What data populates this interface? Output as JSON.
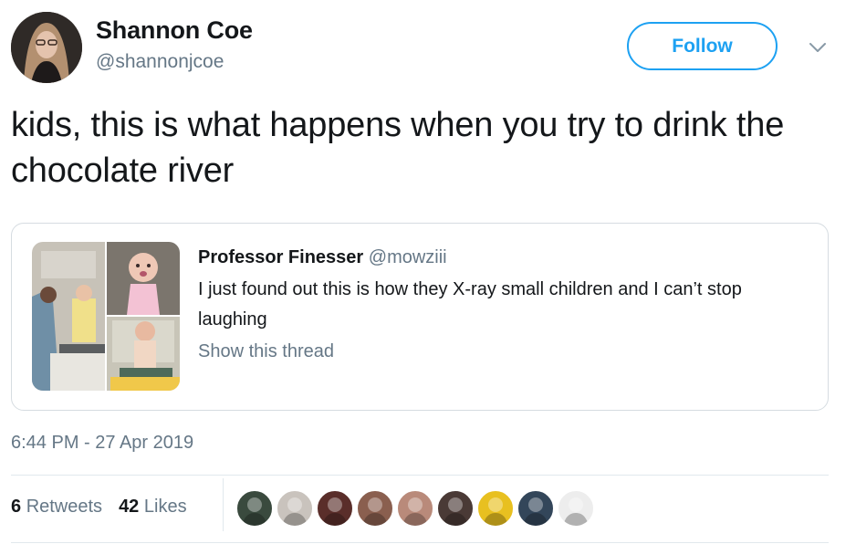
{
  "author": {
    "name": "Shannon Coe",
    "handle": "@shannonjcoe",
    "avatar_icon": "user-avatar-photo"
  },
  "follow_label": "Follow",
  "tweet_text": "kids, this is what happens when you try to drink the chocolate river",
  "quoted": {
    "name": "Professor Finesser",
    "handle": "@mowziii",
    "text": "I just found out this is how they X-ray small children and I can’t stop laughing",
    "show_thread": "Show this thread"
  },
  "timestamp": "6:44 PM - 27 Apr 2019",
  "stats": {
    "retweets_count": "6",
    "retweets_label": "Retweets",
    "likes_count": "42",
    "likes_label": "Likes"
  },
  "likers": [
    {
      "name": "liker-avatar-1",
      "color": "#3a4a3e"
    },
    {
      "name": "liker-avatar-2",
      "color": "#c9c3bd"
    },
    {
      "name": "liker-avatar-3",
      "color": "#5a2e2a"
    },
    {
      "name": "liker-avatar-4",
      "color": "#8a5f4f"
    },
    {
      "name": "liker-avatar-5",
      "color": "#b98a7a"
    },
    {
      "name": "liker-avatar-6",
      "color": "#4a3a36"
    },
    {
      "name": "liker-avatar-7",
      "color": "#e8c020"
    },
    {
      "name": "liker-avatar-8",
      "color": "#33465a"
    },
    {
      "name": "liker-avatar-9",
      "color": "#ededed"
    }
  ],
  "colors": {
    "accent": "#1da1f2",
    "text": "#14171a",
    "secondary": "#657786",
    "border": "#e1e8ed"
  }
}
